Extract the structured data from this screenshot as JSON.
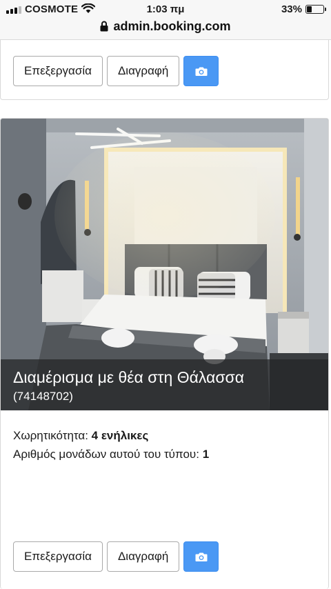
{
  "status_bar": {
    "carrier": "COSMOTE",
    "time": "1:03 πμ",
    "battery": "33%",
    "battery_level": 0.33
  },
  "browser": {
    "url": "admin.booking.com"
  },
  "top_card": {
    "edit_label": "Επεξεργασία",
    "delete_label": "Διαγραφή",
    "photo_icon": "camera-icon"
  },
  "room_card": {
    "title": "Διαμέρισμα με θέα στη Θάλασσα",
    "room_id": "(74148702)",
    "capacity_label": "Χωρητικότητα:",
    "capacity_value": "4 ενήλικες",
    "units_label": "Αριθμός μονάδων αυτού του τύπου:",
    "units_value": "1",
    "edit_label": "Επεξεργασία",
    "delete_label": "Διαγραφή",
    "photo_icon": "camera-icon"
  },
  "colors": {
    "primary_button": "#4a98f4",
    "caption_overlay": "#232426"
  }
}
